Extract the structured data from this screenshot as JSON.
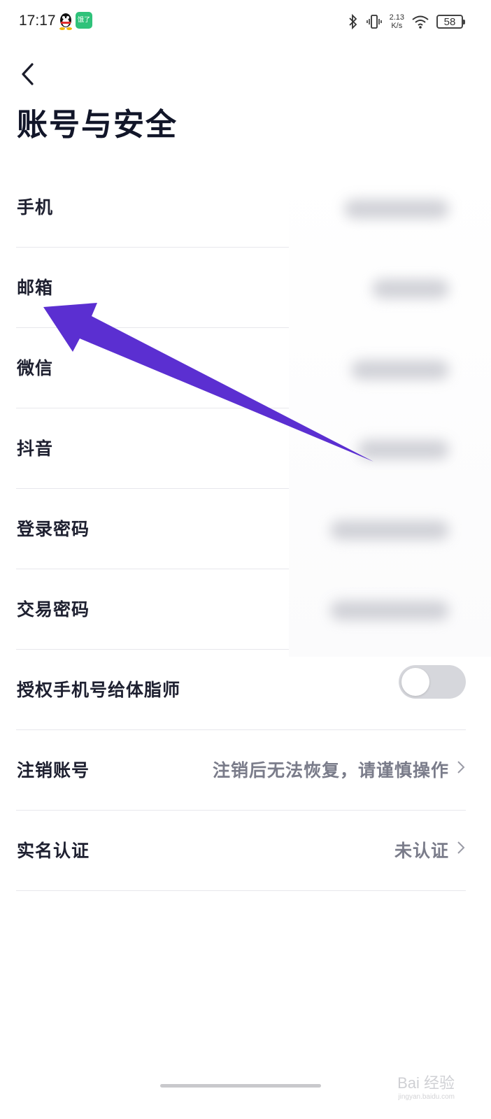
{
  "status_bar": {
    "time": "17:17",
    "app_badge": "饿了",
    "network_speed": "2.13",
    "network_unit": "K/s",
    "battery": "58"
  },
  "header": {
    "title": "账号与安全"
  },
  "rows": [
    {
      "label": "手机"
    },
    {
      "label": "邮箱"
    },
    {
      "label": "微信"
    },
    {
      "label": "抖音"
    },
    {
      "label": "登录密码"
    },
    {
      "label": "交易密码"
    },
    {
      "label": "授权手机号给体脂师",
      "toggle_on": false
    },
    {
      "label": "注销账号",
      "value": "注销后无法恢复，请谨慎操作"
    },
    {
      "label": "实名认证",
      "value": "未认证"
    }
  ],
  "watermark": {
    "brand": "Bai 经验",
    "url": "jingyan.baidu.com"
  },
  "colors": {
    "annotation_arrow": "#5b2fd1",
    "title": "#121629",
    "secondary_text": "#7a7c8a",
    "divider": "#e7e7ec"
  }
}
